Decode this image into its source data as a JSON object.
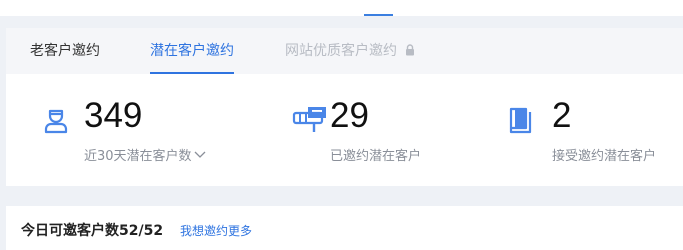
{
  "tabs": [
    {
      "label": "老客户邀约",
      "state": "normal"
    },
    {
      "label": "潜在客户邀约",
      "state": "active"
    },
    {
      "label": "网站优质客户邀约",
      "state": "locked"
    }
  ],
  "stats": [
    {
      "icon": "person-icon",
      "value": "349",
      "label": "近30天潜在客户数"
    },
    {
      "icon": "mailbox-icon",
      "value": "29",
      "label": "已邀约潜在客户"
    },
    {
      "icon": "book-icon",
      "value": "2",
      "label": "接受邀约潜在客户"
    }
  ],
  "quota": {
    "text": "今日可邀客户数52/52",
    "more_link": "我想邀约更多"
  },
  "colors": {
    "accent": "#2f74e0",
    "icon": "#4a86e8",
    "muted": "#8a8f99",
    "disabled": "#b8bcc4",
    "background": "#eef1f6"
  }
}
